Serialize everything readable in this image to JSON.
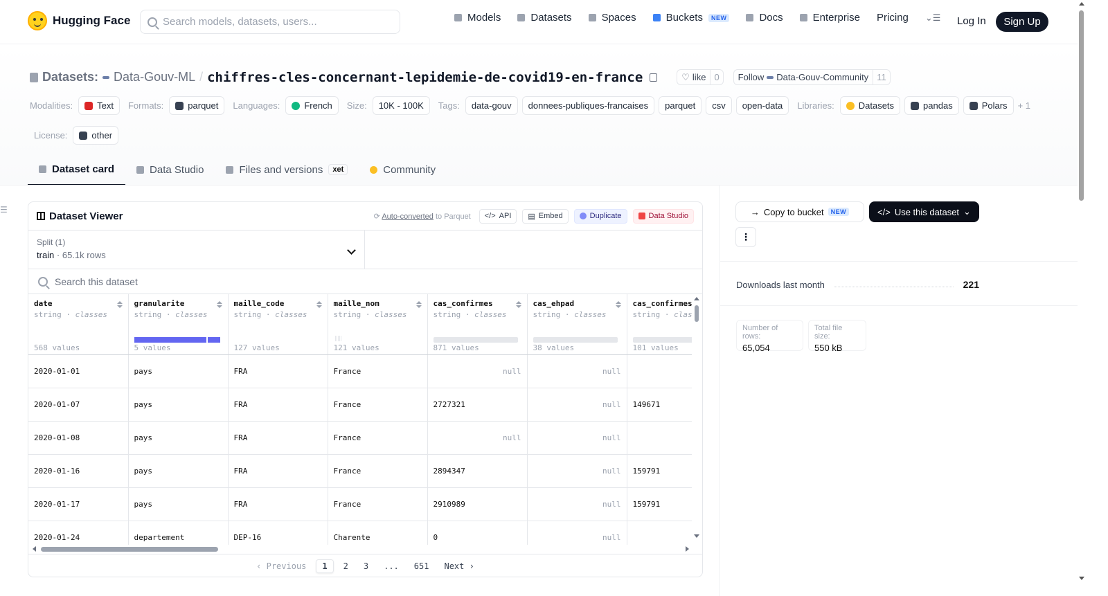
{
  "header": {
    "logo_text": "Hugging Face",
    "search_placeholder": "Search models, datasets, users...",
    "nav": [
      {
        "label": "Models",
        "icon": "models-icon"
      },
      {
        "label": "Datasets",
        "icon": "datasets-icon"
      },
      {
        "label": "Spaces",
        "icon": "spaces-icon"
      },
      {
        "label": "Buckets",
        "icon": "buckets-icon",
        "badge": "NEW"
      },
      {
        "label": "Docs",
        "icon": "docs-icon"
      },
      {
        "label": "Enterprise",
        "icon": "enterprise-icon"
      },
      {
        "label": "Pricing"
      }
    ],
    "login": "Log In",
    "signup": "Sign Up"
  },
  "repo": {
    "crumb_label": "Datasets:",
    "org": "Data-Gouv-ML",
    "name": "chiffres-cles-concernant-lepidemie-de-covid19-en-france",
    "like_label": "like",
    "like_count": "0",
    "follow_label": "Follow",
    "follow_org": "Data-Gouv-Community",
    "follow_count": "11"
  },
  "tags": {
    "modalities_label": "Modalities:",
    "modality": "Text",
    "formats_label": "Formats:",
    "format": "parquet",
    "languages_label": "Languages:",
    "language": "French",
    "size_label": "Size:",
    "size": "10K - 100K",
    "tags_label": "Tags:",
    "tag_list": [
      "data-gouv",
      "donnees-publiques-francaises",
      "parquet",
      "csv",
      "open-data"
    ],
    "libraries_label": "Libraries:",
    "libraries": [
      "Datasets",
      "pandas",
      "Polars"
    ],
    "more": "+ 1",
    "license_label": "License:",
    "license": "other"
  },
  "tabs": {
    "dataset_card": "Dataset card",
    "data_studio": "Data Studio",
    "files": "Files and versions",
    "xet": "xet",
    "community": "Community"
  },
  "viewer": {
    "title": "Dataset Viewer",
    "auto_converted": "Auto-converted",
    "to_parquet": "to Parquet",
    "api": "API",
    "embed": "Embed",
    "duplicate": "Duplicate",
    "data_studio": "Data Studio",
    "split_label": "Split (1)",
    "split_name": "train",
    "split_rows": "65.1k rows",
    "search_placeholder": "Search this dataset",
    "columns": [
      {
        "name": "date",
        "type": "string",
        "kind": "classes",
        "count": "568 values"
      },
      {
        "name": "granularite",
        "type": "string",
        "kind": "classes",
        "count": "5 values"
      },
      {
        "name": "maille_code",
        "type": "string",
        "kind": "classes",
        "count": "127 values"
      },
      {
        "name": "maille_nom",
        "type": "string",
        "kind": "classes",
        "count": "121 values"
      },
      {
        "name": "cas_confirmes",
        "type": "string",
        "kind": "classes",
        "count": "871 values"
      },
      {
        "name": "cas_ehpad",
        "type": "string",
        "kind": "classes",
        "count": "38 values"
      },
      {
        "name": "cas_confirmes_ehpad",
        "type": "string",
        "kind": "classes",
        "count": "101 values"
      }
    ],
    "rows": [
      [
        "2020-01-01",
        "pays",
        "FRA",
        "France",
        "null",
        "null",
        ""
      ],
      [
        "2020-01-07",
        "pays",
        "FRA",
        "France",
        "2727321",
        "null",
        "149671"
      ],
      [
        "2020-01-08",
        "pays",
        "FRA",
        "France",
        "null",
        "null",
        ""
      ],
      [
        "2020-01-16",
        "pays",
        "FRA",
        "France",
        "2894347",
        "null",
        "159791"
      ],
      [
        "2020-01-17",
        "pays",
        "FRA",
        "France",
        "2910989",
        "null",
        "159791"
      ],
      [
        "2020-01-24",
        "departement",
        "DEP-16",
        "Charente",
        "0",
        "null",
        ""
      ]
    ],
    "pager": {
      "previous": "Previous",
      "pages": [
        "1",
        "2",
        "3",
        "...",
        "651"
      ],
      "next": "Next"
    }
  },
  "sidebar": {
    "copy_bucket": "Copy to bucket",
    "new_badge": "NEW",
    "use_dataset": "Use this dataset",
    "downloads_label": "Downloads last month",
    "downloads_value": "221",
    "rows_label": "Number of rows:",
    "rows_value": "65,054",
    "filesize_label": "Total file size:",
    "filesize_value": "550 kB"
  },
  "colors": {
    "accent": "#6366f1",
    "primary_dark": "#111827"
  }
}
